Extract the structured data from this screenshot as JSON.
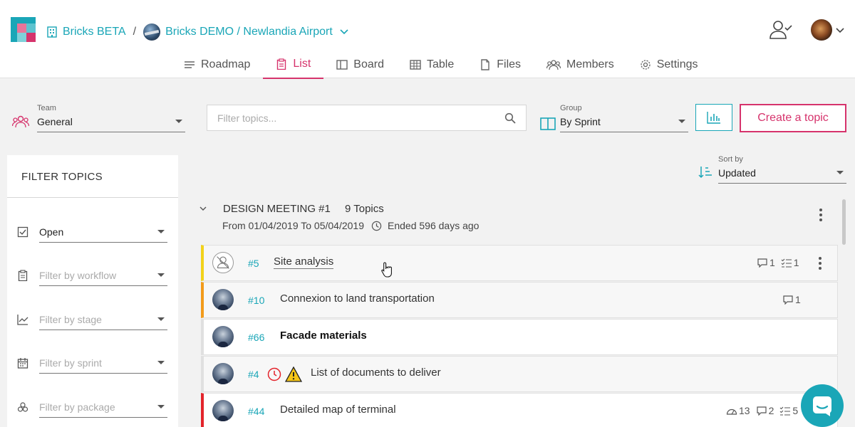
{
  "header": {
    "org": "Bricks BETA",
    "separator": "/",
    "project": "Bricks DEMO / Newlandia Airport"
  },
  "tabs": [
    {
      "label": "Roadmap",
      "icon": "menu-icon"
    },
    {
      "label": "List",
      "icon": "clipboard-icon",
      "active": true
    },
    {
      "label": "Board",
      "icon": "board-icon"
    },
    {
      "label": "Table",
      "icon": "table-icon"
    },
    {
      "label": "Files",
      "icon": "file-icon"
    },
    {
      "label": "Members",
      "icon": "members-icon"
    },
    {
      "label": "Settings",
      "icon": "gear-icon"
    }
  ],
  "toolbar": {
    "team_label": "Team",
    "team_value": "General",
    "search_placeholder": "Filter topics...",
    "group_label": "Group",
    "group_value": "By Sprint",
    "create_label": "Create a topic",
    "sort_label": "Sort by",
    "sort_value": "Updated"
  },
  "sidebar": {
    "title": "FILTER TOPICS",
    "filters": [
      {
        "value": "Open",
        "icon": "checkbox-icon",
        "filled": true
      },
      {
        "value": "Filter by workflow",
        "icon": "clipboard-icon"
      },
      {
        "value": "Filter by stage",
        "icon": "chart-line-icon"
      },
      {
        "value": "Filter by sprint",
        "icon": "calendar-icon"
      },
      {
        "value": "Filter by package",
        "icon": "package-icon"
      }
    ]
  },
  "sprint": {
    "name": "DESIGN MEETING #1",
    "count": "9 Topics",
    "dates": "From 01/04/2019  To 05/04/2019",
    "ended": "Ended 596 days ago"
  },
  "topics": [
    {
      "num": "#5",
      "title": "Site analysis",
      "accent": "#f2d21b",
      "comments": "1",
      "tasks": "1"
    },
    {
      "num": "#10",
      "title": "Connexion to land transportation",
      "accent": "#f29b1b",
      "comments": "1"
    },
    {
      "num": "#66",
      "title": "Facade materials",
      "accent": "#e0e0e0"
    },
    {
      "num": "#4",
      "title": "List of documents to deliver",
      "accent": "#e0e0e0"
    },
    {
      "num": "#44",
      "title": "Detailed map of terminal",
      "accent": "#e3242b",
      "views": "13",
      "comments": "2",
      "tasks": "5"
    }
  ],
  "colors": {
    "accent": "#1aa6b7",
    "brand": "#d6336c"
  }
}
